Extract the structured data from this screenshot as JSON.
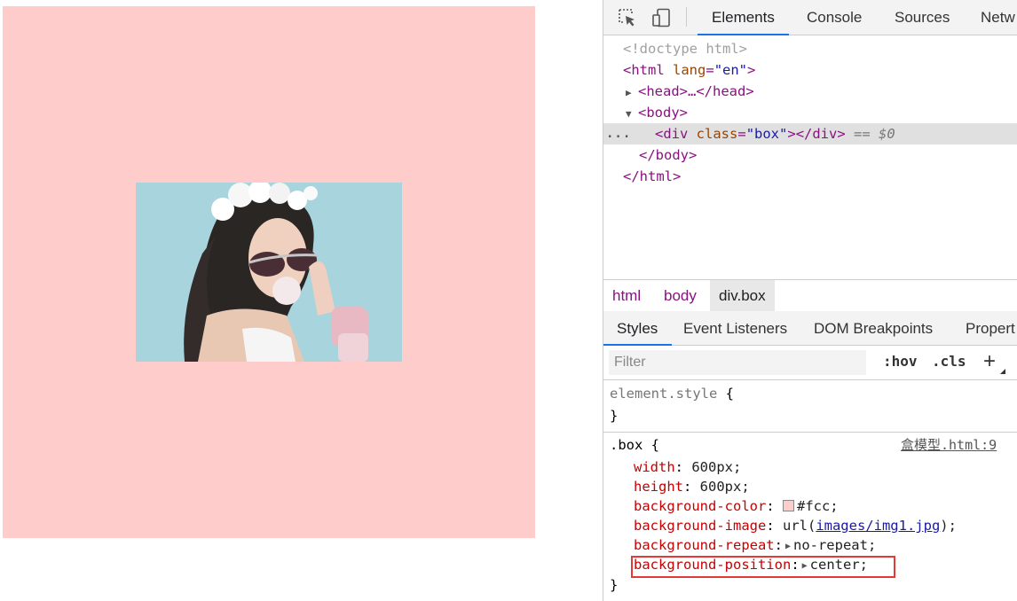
{
  "preview": {
    "box_color": "#ffcccc",
    "image_alt": "woman with sunglasses blowing bubble gum"
  },
  "devtools": {
    "tabs": [
      "Elements",
      "Console",
      "Sources",
      "Netw"
    ],
    "active_tab": "Elements",
    "dom": {
      "doctype": "<!doctype html>",
      "html_open_tag": "<html",
      "html_attr": "lang",
      "html_attr_eq": "=",
      "html_attr_val": "\"en\"",
      "html_open_end": ">",
      "head": "<head>…</head>",
      "body_open": "<body>",
      "div_open": "<div",
      "div_attr": "class",
      "div_attr_eq": "=",
      "div_attr_val": "\"box\"",
      "div_close": "></div>",
      "eq_sign": "==",
      "dollar": "$0",
      "body_close": "</body>",
      "html_close": "</html>",
      "dots": "..."
    },
    "breadcrumbs": [
      "html",
      "body",
      "div.box"
    ],
    "subtabs": [
      "Styles",
      "Event Listeners",
      "DOM Breakpoints",
      "Propert"
    ],
    "filter_placeholder": "Filter",
    "hov": ":hov",
    "cls": ".cls",
    "plus": "+",
    "element_style": {
      "selector": "element.style",
      "open": "{",
      "close": "}"
    },
    "box_rule": {
      "selector": ".box",
      "open": "{",
      "close": "}",
      "source": "盒模型.html:9",
      "declarations": [
        {
          "prop": "width",
          "value": "600px;"
        },
        {
          "prop": "height",
          "value": "600px;"
        },
        {
          "prop": "background-color",
          "value": "#fcc;"
        },
        {
          "prop": "background-image",
          "url_prefix": "url(",
          "url": "images/img1.jpg",
          "url_suffix": ");"
        },
        {
          "prop": "background-repeat",
          "value": "no-repeat;"
        },
        {
          "prop": "background-position",
          "value": "center;"
        }
      ]
    }
  }
}
